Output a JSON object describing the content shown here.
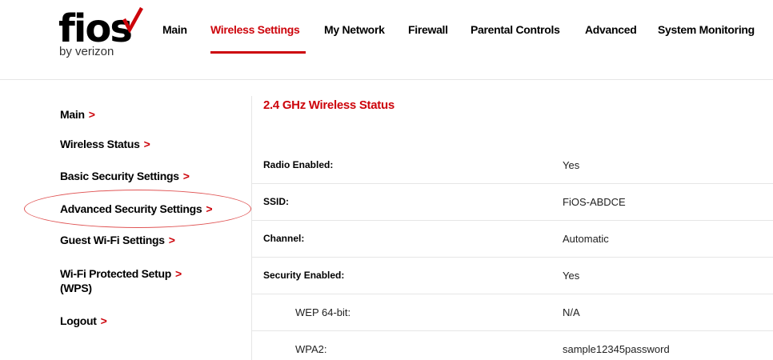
{
  "brand": {
    "word": "fios",
    "sub": "by verizon",
    "accent": "#cd040b"
  },
  "nav": {
    "items": [
      {
        "label": "Main"
      },
      {
        "label": "Wireless Settings"
      },
      {
        "label": "My Network"
      },
      {
        "label": "Firewall"
      },
      {
        "label": "Parental Controls"
      },
      {
        "label": "Advanced"
      },
      {
        "label": "System Monitoring"
      }
    ],
    "active": "Wireless Settings"
  },
  "sidebar": {
    "items": [
      {
        "label": "Main"
      },
      {
        "label": "Wireless Status"
      },
      {
        "label": "Basic Security Settings"
      },
      {
        "label": "Advanced Security Settings"
      },
      {
        "label": "Guest Wi-Fi Settings"
      },
      {
        "label": "Wi-Fi Protected Setup",
        "label2": "(WPS)"
      },
      {
        "label": "Logout"
      }
    ],
    "chevron": ">"
  },
  "main": {
    "title": "2.4 GHz Wireless Status",
    "rows": [
      {
        "label": "Radio Enabled:",
        "value": "Yes"
      },
      {
        "label": "SSID:",
        "value": "FiOS-ABDCE"
      },
      {
        "label": "Channel:",
        "value": "Automatic"
      },
      {
        "label": "Security Enabled:",
        "value": "Yes"
      },
      {
        "label": "WEP 64-bit:",
        "value": "N/A"
      },
      {
        "label": "WPA2:",
        "value": "sample12345password"
      }
    ]
  }
}
